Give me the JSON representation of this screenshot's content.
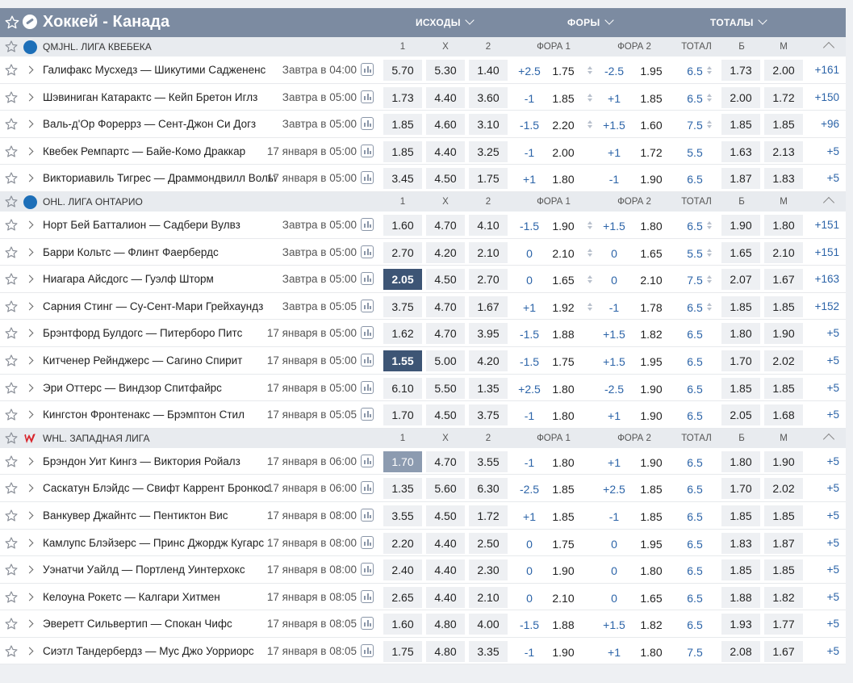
{
  "header": {
    "title": "Хоккей - Канада",
    "groups": [
      "ИСХОДЫ",
      "ФОРЫ",
      "ТОТАЛЫ"
    ]
  },
  "columns": {
    "c1": "1",
    "cx": "X",
    "c2": "2",
    "f1": "ФОРА 1",
    "f2": "ФОРА 2",
    "tot": "ТОТАЛ",
    "b": "Б",
    "m": "М"
  },
  "colors": {
    "header_bg": "#7c8ba1",
    "selected": "#3d5575",
    "selected_light": "#8c9bb0",
    "link": "#2c64a8"
  },
  "leagues": [
    {
      "name": "QMJHL. ЛИГА КВЕБЕКА",
      "logo": "qmjhl-logo",
      "matches": [
        {
          "teams": "Галифакс Мусхедз — Шикутими Саджененс",
          "time": "Завтра в 04:00",
          "o1": "5.70",
          "ox": "5.30",
          "o2": "1.40",
          "f1v": "+2.5",
          "f1k": "1.75",
          "f2v": "-2.5",
          "f2k": "1.95",
          "tv": "6.5",
          "tb": "1.73",
          "tm": "2.00",
          "more": "+161",
          "arrows": true
        },
        {
          "teams": "Шэвиниган Катарактс — Кейп Бретон Иглз",
          "time": "Завтра в 05:00",
          "o1": "1.73",
          "ox": "4.40",
          "o2": "3.60",
          "f1v": "-1",
          "f1k": "1.85",
          "f2v": "+1",
          "f2k": "1.85",
          "tv": "6.5",
          "tb": "2.00",
          "tm": "1.72",
          "more": "+150",
          "arrows": true
        },
        {
          "teams": "Валь-д'Ор Фореррз — Сент-Джон Си Догз",
          "time": "Завтра в 05:00",
          "o1": "1.85",
          "ox": "4.60",
          "o2": "3.10",
          "f1v": "-1.5",
          "f1k": "2.20",
          "f2v": "+1.5",
          "f2k": "1.60",
          "tv": "7.5",
          "tb": "1.85",
          "tm": "1.85",
          "more": "+96",
          "arrows": true
        },
        {
          "teams": "Квебек Ремпартс — Байе-Комо Драккар",
          "time": "17 января в 05:00",
          "o1": "1.85",
          "ox": "4.40",
          "o2": "3.25",
          "f1v": "-1",
          "f1k": "2.00",
          "f2v": "+1",
          "f2k": "1.72",
          "tv": "5.5",
          "tb": "1.63",
          "tm": "2.13",
          "more": "+5",
          "arrows": false
        },
        {
          "teams": "Викториавиль Тигрес — Драммондвилл Вольтижерс",
          "time": "17 января в 05:00",
          "o1": "3.45",
          "ox": "4.50",
          "o2": "1.75",
          "f1v": "+1",
          "f1k": "1.80",
          "f2v": "-1",
          "f2k": "1.90",
          "tv": "6.5",
          "tb": "1.87",
          "tm": "1.83",
          "more": "+5",
          "arrows": false
        }
      ]
    },
    {
      "name": "OHL. ЛИГА ОНТАРИО",
      "logo": "ohl-logo",
      "matches": [
        {
          "teams": "Норт Бей Батталион — Садбери Вулвз",
          "time": "Завтра в 05:00",
          "o1": "1.60",
          "ox": "4.70",
          "o2": "4.10",
          "f1v": "-1.5",
          "f1k": "1.90",
          "f2v": "+1.5",
          "f2k": "1.80",
          "tv": "6.5",
          "tb": "1.90",
          "tm": "1.80",
          "more": "+151",
          "arrows": true
        },
        {
          "teams": "Барри Кольтс — Флинт Фаербердс",
          "time": "Завтра в 05:00",
          "o1": "2.70",
          "ox": "4.20",
          "o2": "2.10",
          "f1v": "0",
          "f1k": "2.10",
          "f2v": "0",
          "f2k": "1.65",
          "tv": "5.5",
          "tb": "1.65",
          "tm": "2.10",
          "more": "+151",
          "arrows": true
        },
        {
          "teams": "Ниагара Айсдогс — Гуэлф Шторм",
          "time": "Завтра в 05:00",
          "o1": "2.05",
          "ox": "4.50",
          "o2": "2.70",
          "f1v": "0",
          "f1k": "1.65",
          "f2v": "0",
          "f2k": "2.10",
          "tv": "7.5",
          "tb": "2.07",
          "tm": "1.67",
          "more": "+163",
          "arrows": true,
          "sel": "dark"
        },
        {
          "teams": "Сарния Стинг — Су-Сент-Мари Грейхаундз",
          "time": "Завтра в 05:05",
          "o1": "3.75",
          "ox": "4.70",
          "o2": "1.67",
          "f1v": "+1",
          "f1k": "1.92",
          "f2v": "-1",
          "f2k": "1.78",
          "tv": "6.5",
          "tb": "1.85",
          "tm": "1.85",
          "more": "+152",
          "arrows": true
        },
        {
          "teams": "Брэнтфорд Булдогс — Питерборо Питс",
          "time": "17 января в 05:00",
          "o1": "1.62",
          "ox": "4.70",
          "o2": "3.95",
          "f1v": "-1.5",
          "f1k": "1.88",
          "f2v": "+1.5",
          "f2k": "1.82",
          "tv": "6.5",
          "tb": "1.80",
          "tm": "1.90",
          "more": "+5",
          "arrows": false
        },
        {
          "teams": "Китченер Рейнджерс — Сагино Спирит",
          "time": "17 января в 05:00",
          "o1": "1.55",
          "ox": "5.00",
          "o2": "4.20",
          "f1v": "-1.5",
          "f1k": "1.75",
          "f2v": "+1.5",
          "f2k": "1.95",
          "tv": "6.5",
          "tb": "1.70",
          "tm": "2.02",
          "more": "+5",
          "arrows": false,
          "sel": "dark"
        },
        {
          "teams": "Эри Оттерс — Виндзор Спитфайрс",
          "time": "17 января в 05:00",
          "o1": "6.10",
          "ox": "5.50",
          "o2": "1.35",
          "f1v": "+2.5",
          "f1k": "1.80",
          "f2v": "-2.5",
          "f2k": "1.90",
          "tv": "6.5",
          "tb": "1.85",
          "tm": "1.85",
          "more": "+5",
          "arrows": false
        },
        {
          "teams": "Кингстон Фронтенакс — Брэмптон Стил",
          "time": "17 января в 05:05",
          "o1": "1.70",
          "ox": "4.50",
          "o2": "3.75",
          "f1v": "-1",
          "f1k": "1.80",
          "f2v": "+1",
          "f2k": "1.90",
          "tv": "6.5",
          "tb": "2.05",
          "tm": "1.68",
          "more": "+5",
          "arrows": false
        }
      ]
    },
    {
      "name": "WHL. ЗАПАДНАЯ ЛИГА",
      "logo": "whl-logo",
      "matches": [
        {
          "teams": "Брэндон Уит Кингз — Виктория Ройалз",
          "time": "17 января в 06:00",
          "o1": "1.70",
          "ox": "4.70",
          "o2": "3.55",
          "f1v": "-1",
          "f1k": "1.80",
          "f2v": "+1",
          "f2k": "1.90",
          "tv": "6.5",
          "tb": "1.80",
          "tm": "1.90",
          "more": "+5",
          "arrows": false,
          "sel": "light"
        },
        {
          "teams": "Саскатун Блэйдс — Свифт Каррент Бронкос",
          "time": "17 января в 06:00",
          "o1": "1.35",
          "ox": "5.60",
          "o2": "6.30",
          "f1v": "-2.5",
          "f1k": "1.85",
          "f2v": "+2.5",
          "f2k": "1.85",
          "tv": "6.5",
          "tb": "1.70",
          "tm": "2.02",
          "more": "+5",
          "arrows": false
        },
        {
          "teams": "Ванкувер Джайнтс — Пентиктон Вис",
          "time": "17 января в 08:00",
          "o1": "3.55",
          "ox": "4.50",
          "o2": "1.72",
          "f1v": "+1",
          "f1k": "1.85",
          "f2v": "-1",
          "f2k": "1.85",
          "tv": "6.5",
          "tb": "1.85",
          "tm": "1.85",
          "more": "+5",
          "arrows": false
        },
        {
          "teams": "Камлупс Блэйзерс — Принс Джордж Кугарс",
          "time": "17 января в 08:00",
          "o1": "2.20",
          "ox": "4.40",
          "o2": "2.50",
          "f1v": "0",
          "f1k": "1.75",
          "f2v": "0",
          "f2k": "1.95",
          "tv": "6.5",
          "tb": "1.83",
          "tm": "1.87",
          "more": "+5",
          "arrows": false
        },
        {
          "teams": "Уэнатчи Уайлд — Портленд Уинтерхокс",
          "time": "17 января в 08:00",
          "o1": "2.40",
          "ox": "4.40",
          "o2": "2.30",
          "f1v": "0",
          "f1k": "1.90",
          "f2v": "0",
          "f2k": "1.80",
          "tv": "6.5",
          "tb": "1.85",
          "tm": "1.85",
          "more": "+5",
          "arrows": false
        },
        {
          "teams": "Келоуна Рокетс — Калгари Хитмен",
          "time": "17 января в 08:05",
          "o1": "2.65",
          "ox": "4.40",
          "o2": "2.10",
          "f1v": "0",
          "f1k": "2.10",
          "f2v": "0",
          "f2k": "1.65",
          "tv": "6.5",
          "tb": "1.88",
          "tm": "1.82",
          "more": "+5",
          "arrows": false
        },
        {
          "teams": "Эверетт Сильвертип — Спокан Чифс",
          "time": "17 января в 08:05",
          "o1": "1.60",
          "ox": "4.80",
          "o2": "4.00",
          "f1v": "-1.5",
          "f1k": "1.88",
          "f2v": "+1.5",
          "f2k": "1.82",
          "tv": "6.5",
          "tb": "1.93",
          "tm": "1.77",
          "more": "+5",
          "arrows": false
        },
        {
          "teams": "Сиэтл Тандербердз — Мус Джо Уорриорс",
          "time": "17 января в 08:05",
          "o1": "1.75",
          "ox": "4.80",
          "o2": "3.35",
          "f1v": "-1",
          "f1k": "1.90",
          "f2v": "+1",
          "f2k": "1.80",
          "tv": "7.5",
          "tb": "2.08",
          "tm": "1.67",
          "more": "+5",
          "arrows": false
        }
      ]
    }
  ]
}
